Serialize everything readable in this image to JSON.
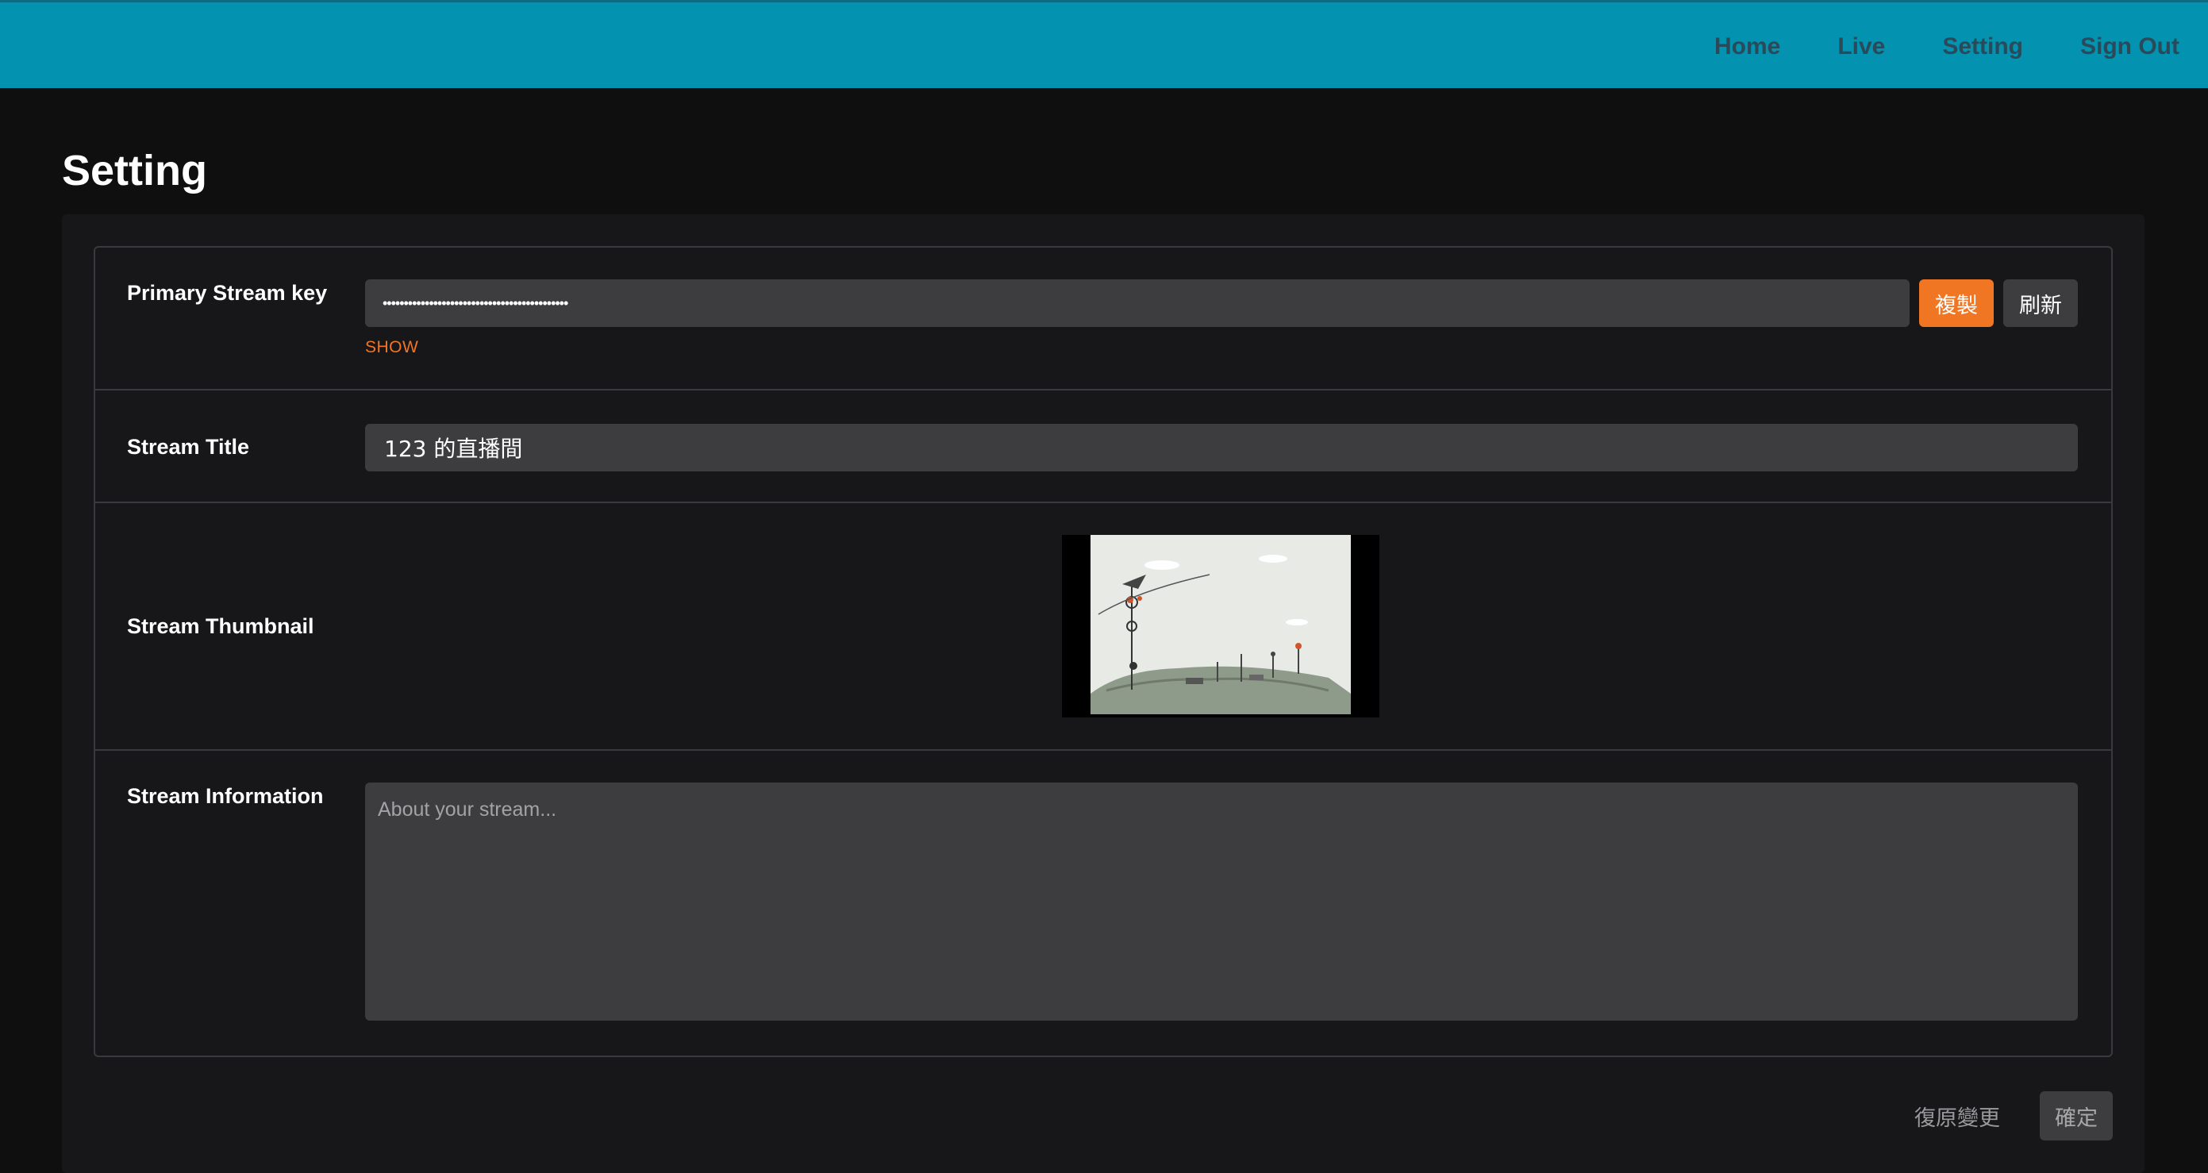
{
  "nav": {
    "items": [
      "Home",
      "Live",
      "Setting",
      "Sign Out"
    ]
  },
  "page": {
    "title": "Setting"
  },
  "form": {
    "stream_key": {
      "label": "Primary Stream key",
      "value": "••••••••••••••••••••••••••••••••••••••••••••",
      "copy_label": "複製",
      "refresh_label": "刷新",
      "show_label": "SHOW"
    },
    "stream_title": {
      "label": "Stream Title",
      "value": "123 的直播間"
    },
    "stream_thumbnail": {
      "label": "Stream Thumbnail"
    },
    "stream_info": {
      "label": "Stream Information",
      "placeholder": "About your stream..."
    }
  },
  "actions": {
    "reset_label": "復原變更",
    "confirm_label": "確定"
  },
  "colors": {
    "topbar": "#0392b0",
    "accent": "#f07623",
    "background": "#0f0f10",
    "panel": "#17171a",
    "input": "#3d3d40"
  }
}
